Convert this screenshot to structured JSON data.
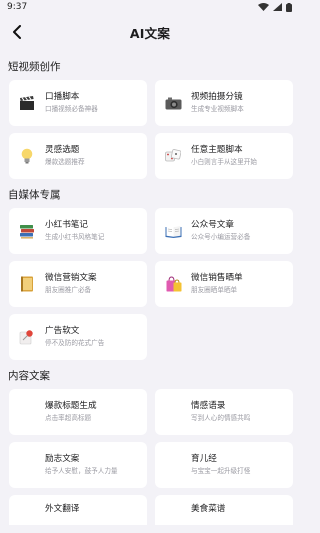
{
  "status": {
    "time": "9:37"
  },
  "header": {
    "title": "AI文案"
  },
  "sections": [
    {
      "title": "短视频创作",
      "cards": [
        {
          "name": "口播脚本",
          "desc": "口播视频必备神器",
          "icon": "clapperboard-icon"
        },
        {
          "name": "视频拍摄分镜",
          "desc": "生成专业视频脚本",
          "icon": "camera-icon"
        },
        {
          "name": "灵感选题",
          "desc": "爆款选题推荐",
          "icon": "lightbulb-icon"
        },
        {
          "name": "任意主题脚本",
          "desc": "小白则言手从这里开始",
          "icon": "dice-icon"
        }
      ]
    },
    {
      "title": "自媒体专属",
      "cards": [
        {
          "name": "小红书笔记",
          "desc": "生成小红书风格笔记",
          "icon": "books-icon"
        },
        {
          "name": "公众号文章",
          "desc": "公众号小编运营必备",
          "icon": "open-book-icon"
        },
        {
          "name": "微信营销文案",
          "desc": "朋友圈推广必备",
          "icon": "notebook-icon"
        },
        {
          "name": "微信销售晒单",
          "desc": "朋友圈晒单晒单",
          "icon": "shopping-bags-icon"
        },
        {
          "name": "广告软文",
          "desc": "停不及防的花式广告",
          "icon": "pushpin-icon"
        }
      ]
    },
    {
      "title": "内容文案",
      "cards": [
        {
          "name": "爆款标题生成",
          "desc": "点击率超高标题"
        },
        {
          "name": "情感语录",
          "desc": "写到人心的情感共鸣"
        },
        {
          "name": "励志文案",
          "desc": "给予人安慰，鼓予人力量"
        },
        {
          "name": "育儿经",
          "desc": "与宝宝一起升级打怪"
        },
        {
          "name": "外文翻译",
          "desc": ""
        },
        {
          "name": "美食菜谱",
          "desc": ""
        }
      ]
    }
  ]
}
